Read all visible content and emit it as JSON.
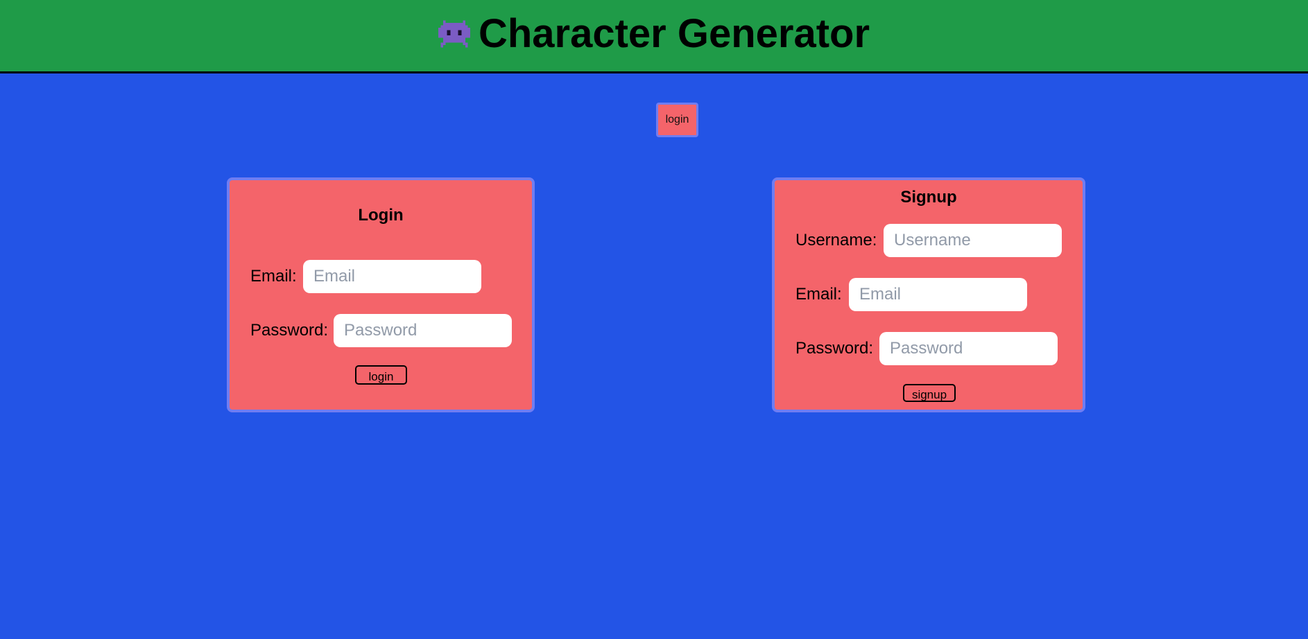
{
  "header": {
    "icon": "alien-monster-icon",
    "title": "Character Generator",
    "colors": {
      "background": "#1f9b48",
      "border": "#000000"
    }
  },
  "nav": {
    "login_button_label": "login"
  },
  "page": {
    "background": "#2354e6",
    "card_color": "#f4646a",
    "card_border_color": "#6f7df2"
  },
  "login_form": {
    "title": "Login",
    "email": {
      "label": "Email:",
      "placeholder": "Email",
      "value": ""
    },
    "password": {
      "label": "Password:",
      "placeholder": "Password",
      "value": ""
    },
    "submit_label": "login"
  },
  "signup_form": {
    "title": "Signup",
    "username": {
      "label": "Username:",
      "placeholder": "Username",
      "value": ""
    },
    "email": {
      "label": "Email:",
      "placeholder": "Email",
      "value": ""
    },
    "password": {
      "label": "Password:",
      "placeholder": "Password",
      "value": ""
    },
    "submit_label": "signup"
  }
}
